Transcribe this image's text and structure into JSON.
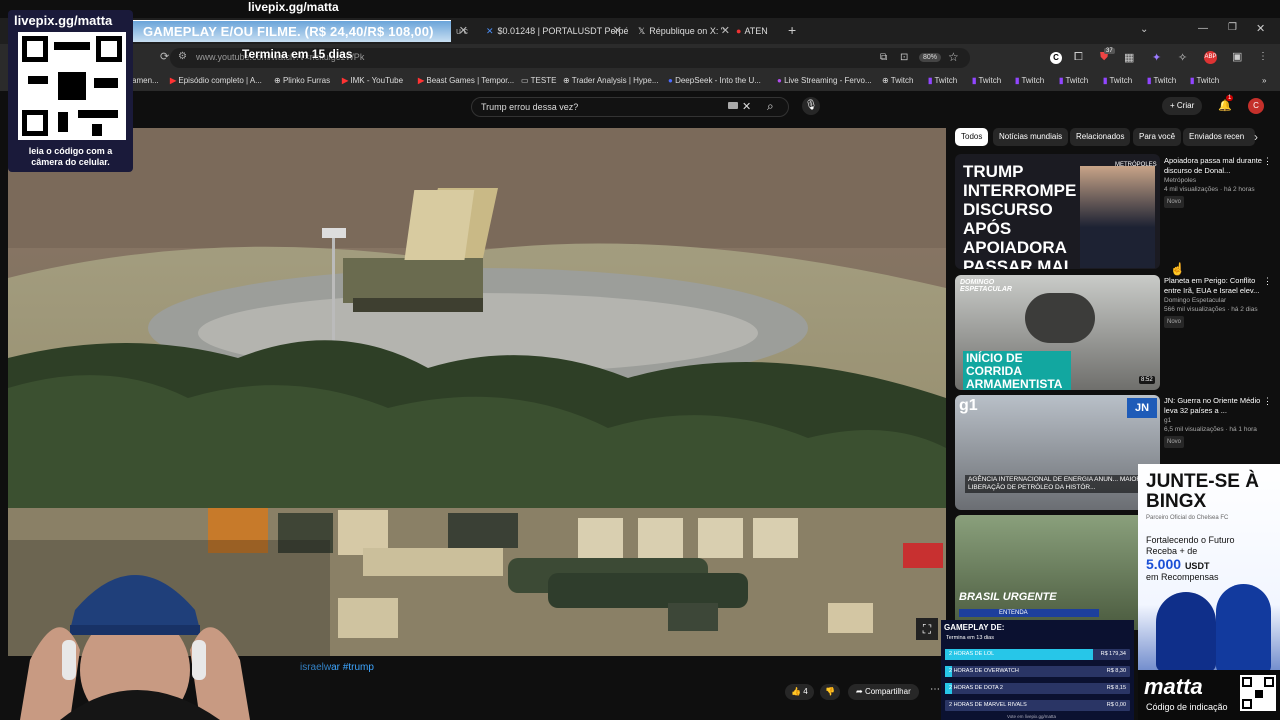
{
  "overlay": {
    "handle": "livepix.gg/matta",
    "handle_top": "livepix.gg/matta",
    "qr_caption": "leia o código com a câmera do celular.",
    "gameplay_banner": "GAMEPLAY E/OU FILME. (R$ 24,40/R$ 108,00)",
    "countdown": "Termina em 15 dias"
  },
  "browser": {
    "tabs": [
      {
        "label": "u c"
      },
      {
        "label": "$0.01248 | PORTALUSDT Perpé"
      },
      {
        "label": "République on X: \""
      },
      {
        "label": "ATEN"
      }
    ],
    "url": "www.youtube.com/watch?v=rickuigc1WPk",
    "zoom": "80%",
    "badge_count": "37",
    "bookmarks": [
      "amen...",
      "Episódio completo | A...",
      "Plinko Furras",
      "IMK - YouTube",
      "Beast Games | Tempor...",
      "TESTE",
      "Trader Analysis | Hype...",
      "DeepSeek - Into the U...",
      "Live Streaming - Fervo...",
      "Twitch",
      "Twitch",
      "Twitch",
      "Twitch",
      "Twitch",
      "Twitch",
      "Twitch",
      "Twitch"
    ]
  },
  "youtube": {
    "search_value": "Trump errou dessa vez?",
    "create_label": "Criar",
    "notif_count": "1",
    "avatar_letter": "C",
    "chips": [
      "Todos",
      "Notícias mundiais",
      "Relacionados",
      "Para você",
      "Enviados recen"
    ],
    "hashtags": "israelwar #trump",
    "likes": "4",
    "share_label": "Compartilhar",
    "recommendations": [
      {
        "title": "Apoiadora passa mal durante discurso de Donal...",
        "channel": "Metrópoles",
        "meta": "4 mil visualizações · há 2 horas",
        "badge": "Novo",
        "thumb_text": "TRUMP INTERROMPE DISCURSO APÓS APOIADORA PASSAR MAL",
        "thumb_brand": "METRÓPOLES"
      },
      {
        "title": "Planeta em Perigo: Conflito entre Irã, EUA e Israel elev...",
        "channel": "Domingo Espetacular",
        "meta": "566 mil visualizações · há 2 dias",
        "badge": "Novo",
        "thumb_text": "INÍCIO DE CORRIDA ARMAMENTISTA",
        "thumb_brand": "DOMINGO ESPETACULAR",
        "duration": "8:52"
      },
      {
        "title": "JN: Guerra no Oriente Médio leva 32 países a ...",
        "channel": "g1",
        "meta": "6,5 mil visualizações · há 1 hora",
        "badge": "Novo",
        "thumb_text": "AGÊNCIA INTERNACIONAL DE ENERGIA ANUN... MAIOR LIBERAÇÃO DE PETRÓLEO DA HISTÓR...",
        "thumb_brand": "g1"
      },
      {
        "title": "",
        "channel": "",
        "meta": "",
        "thumb_text": "BRASIL URGENTE",
        "thumb_brand": "ENTENDA"
      }
    ]
  },
  "bingx": {
    "headline": "JUNTE-SE À BINGX",
    "sub": "Parceiro Oficial do Chelsea FC",
    "line1": "Fortalecendo o Futuro",
    "line2": "Receba + de",
    "amount": "5.000",
    "currency": "USDT",
    "line3": "em Recompensas",
    "brand": "matta",
    "code_caption": "Código de indicação"
  },
  "gameplay_panel": {
    "title": "GAMEPLAY DE:",
    "subtitle": "Termina em 13 dias",
    "rows": [
      {
        "label": "2 HORAS DE LOL",
        "value": "R$ 179,34",
        "fill": 0.8
      },
      {
        "label": "2 HORAS DE OVERWATCH",
        "value": "R$ 8,30",
        "fill": 0.04
      },
      {
        "label": "2 HORAS DE DOTA 2",
        "value": "R$ 8,15",
        "fill": 0.04
      },
      {
        "label": "2 HORAS DE MARVEL RIVALS",
        "value": "R$ 0,00",
        "fill": 0
      }
    ],
    "footer": "Vote em livepix.gg/matta"
  },
  "colors": {
    "accent_red": "#ff0033",
    "progress_cyan": "#27c6e8",
    "bingx_blue": "#1a4fd6"
  }
}
